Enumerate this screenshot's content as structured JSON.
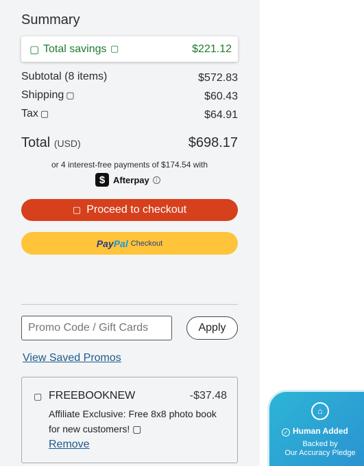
{
  "summary": {
    "title": "Summary",
    "savings": {
      "icon": "tag-icon",
      "label": "Total savings",
      "info_icon": "info-icon",
      "amount": "$221.12",
      "color": "#1f7a2e"
    },
    "subtotal": {
      "label": "Subtotal (8 items)",
      "amount": "$572.83"
    },
    "shipping": {
      "label": "Shipping",
      "amount": "$60.43"
    },
    "tax": {
      "label": "Tax",
      "amount": "$64.91"
    },
    "total": {
      "label": "Total",
      "currency": "(USD)",
      "amount": "$698.17"
    },
    "afterpay": {
      "text": "or 4 interest-free payments of $174.54 with",
      "brand": "Afterpay"
    }
  },
  "buttons": {
    "checkout": {
      "label": "Proceed to checkout",
      "color": "#d6401c"
    },
    "paypal": {
      "brand_part1": "Pay",
      "brand_part2": "Pal",
      "label": "Checkout",
      "color": "#ffc43a"
    }
  },
  "promo": {
    "placeholder": "Promo Code / Gift Cards",
    "apply_label": "Apply",
    "saved_link": "View Saved Promos",
    "applied": {
      "code": "FREEBOOKNEW",
      "amount": "-$37.48",
      "description": "Affiliate Exclusive: Free 8x8 photo book for new customers!",
      "remove_label": "Remove"
    }
  },
  "badge": {
    "title": "Human Added",
    "line1": "Backed by",
    "line2": "Our Accuracy Pledge"
  }
}
